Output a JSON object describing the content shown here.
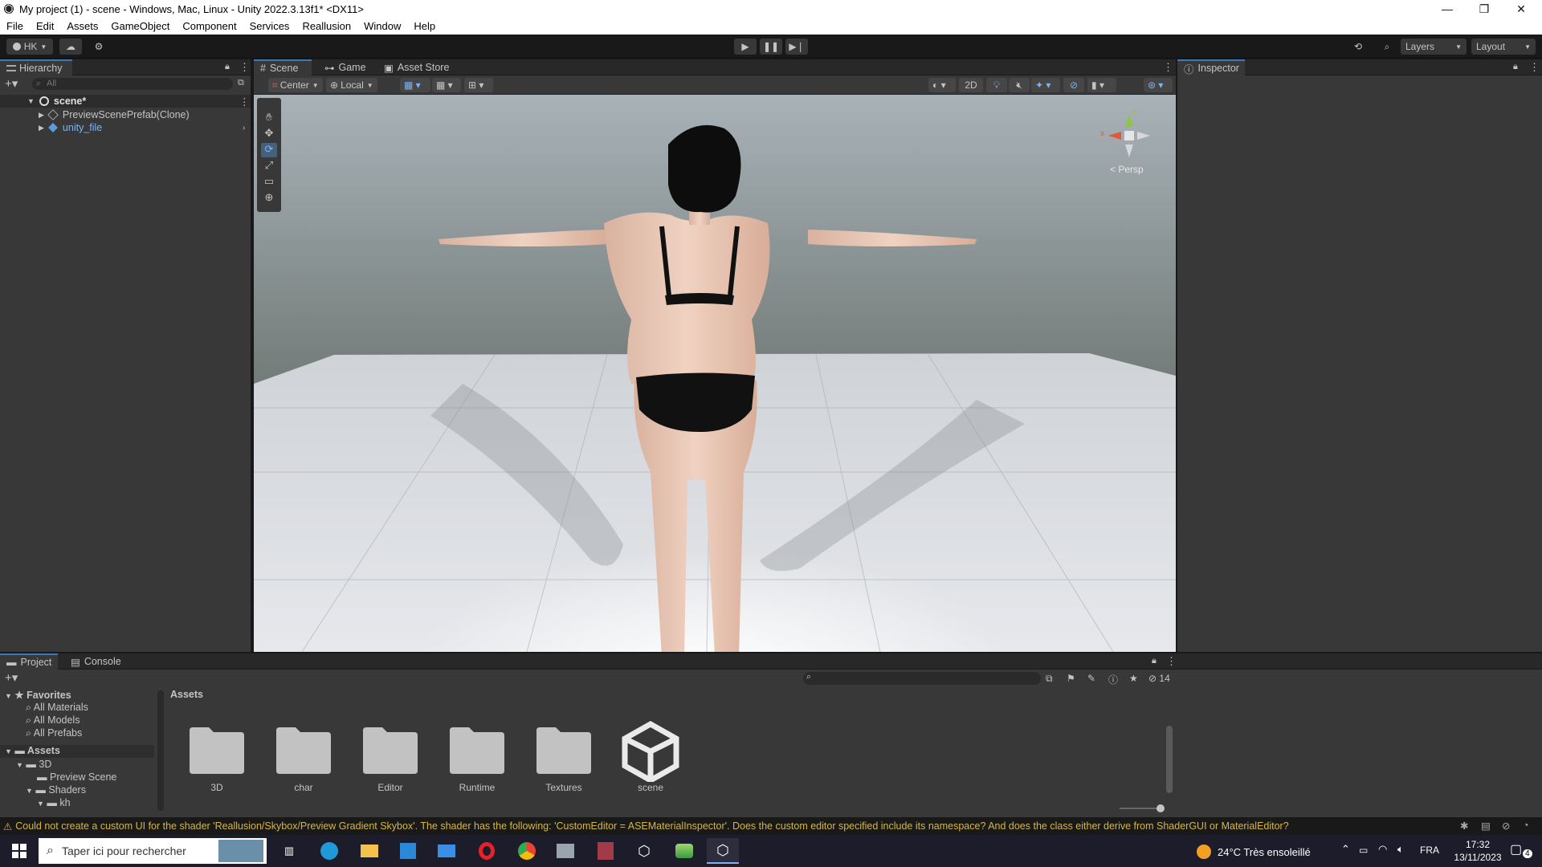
{
  "window": {
    "title": "My project (1) - scene - Windows, Mac, Linux - Unity 2022.3.13f1* <DX11>",
    "minimize": "—",
    "maximize": "❐",
    "close": "✕"
  },
  "menu": [
    "File",
    "Edit",
    "Assets",
    "GameObject",
    "Component",
    "Services",
    "Reallusion",
    "Window",
    "Help"
  ],
  "toolbar": {
    "account": "HK",
    "layers": "Layers",
    "layout": "Layout"
  },
  "hierarchy": {
    "tab": "Hierarchy",
    "search_placeholder": "All",
    "scene": "scene*",
    "items": [
      "PreviewScenePrefab(Clone)",
      "unity_file"
    ]
  },
  "scene_tabs": [
    "Scene",
    "Game",
    "Asset Store"
  ],
  "scene_toolbar": {
    "pivot": "Center",
    "space": "Local",
    "mode_2d": "2D",
    "persp": "Persp"
  },
  "gizmo": {
    "x": "x",
    "y": "y"
  },
  "inspector": {
    "tab": "Inspector"
  },
  "project_tabs": [
    "Project",
    "Console"
  ],
  "project": {
    "favorites_label": "Favorites",
    "favorites": [
      "All Materials",
      "All Models",
      "All Prefabs"
    ],
    "assets_label": "Assets",
    "tree": [
      "3D",
      "Preview Scene",
      "Shaders",
      "kh"
    ],
    "breadcrumb": "Assets",
    "hidden_count": "14",
    "items": [
      "3D",
      "char",
      "Editor",
      "Runtime",
      "Textures",
      "scene"
    ]
  },
  "status": {
    "message": "Could not create a custom UI for the shader 'Reallusion/Skybox/Preview Gradient Skybox'. The shader has the following: 'CustomEditor = ASEMaterialInspector'. Does the custom editor specified include its namespace? And does the class either derive from ShaderGUI or MaterialEditor?"
  },
  "taskbar": {
    "search_placeholder": "Taper ici pour rechercher",
    "weather": "24°C  Très ensoleillé",
    "lang": "FRA",
    "time": "17:32",
    "date": "13/11/2023",
    "notifications": "4"
  },
  "colors": {
    "accent": "#3a79bb",
    "panel": "#383838",
    "dark": "#191919",
    "warning": "#d3b648",
    "prefab_blue": "#7fb2f0"
  }
}
